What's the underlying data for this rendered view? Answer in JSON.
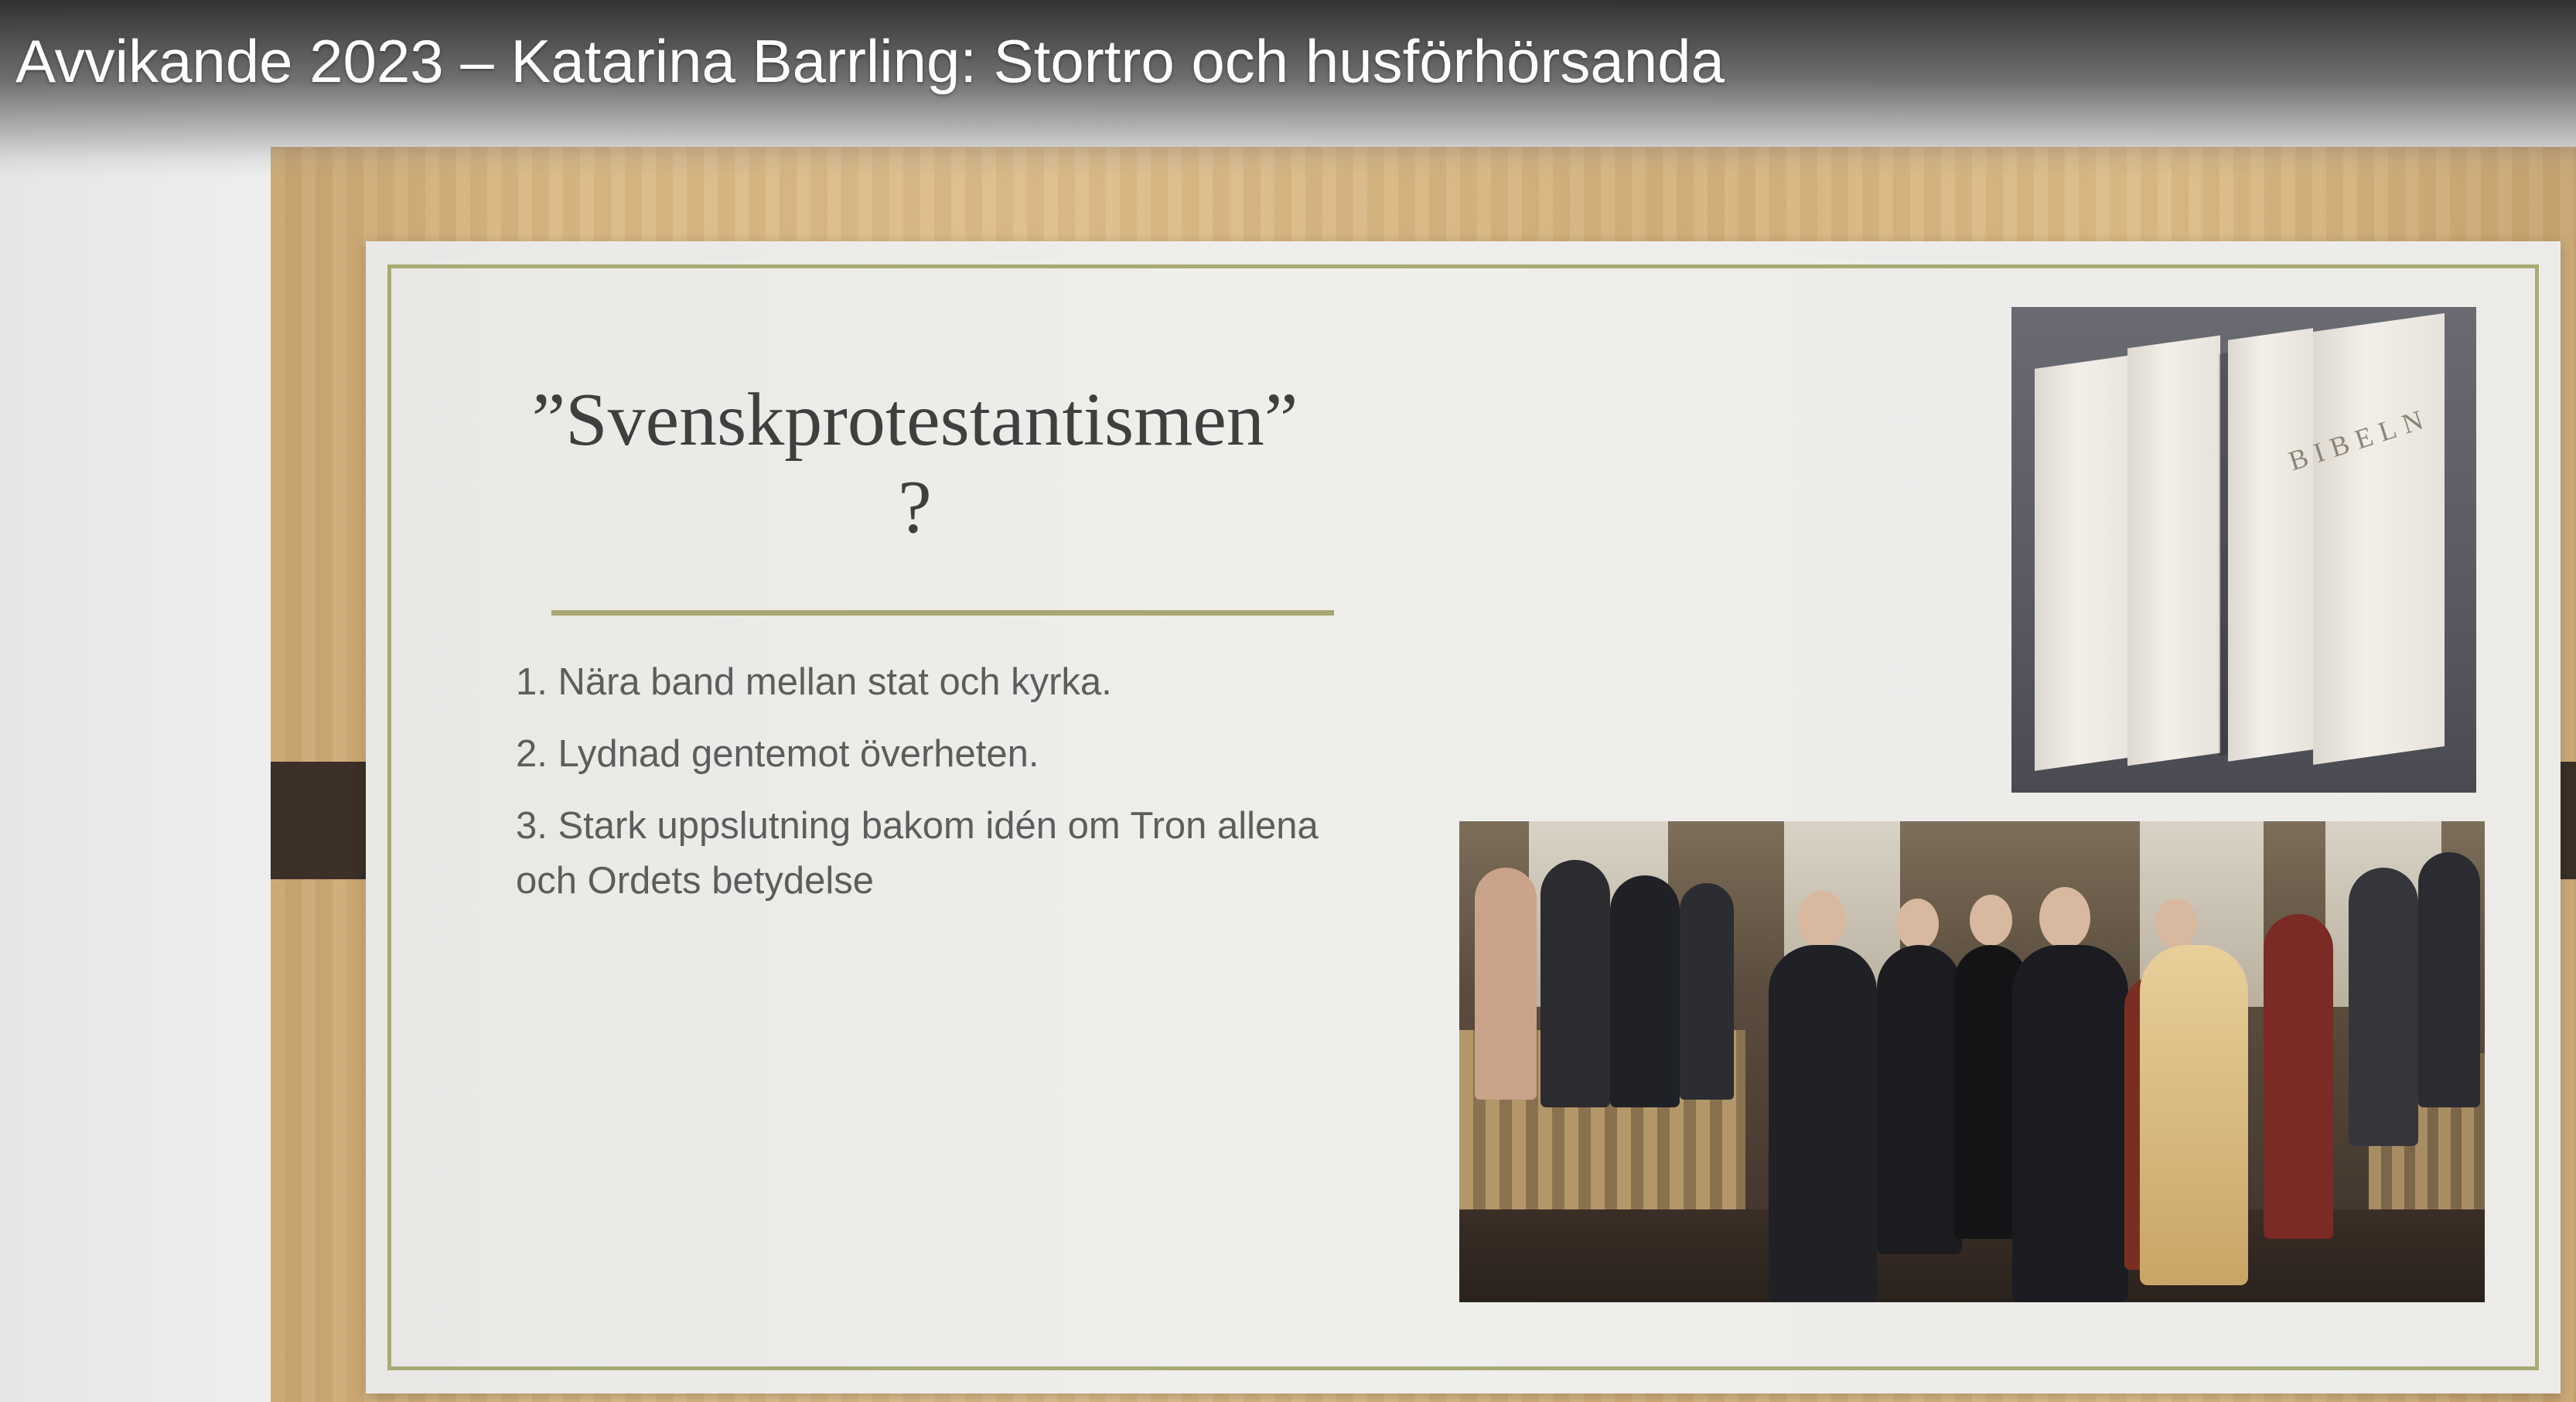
{
  "video": {
    "title": "Avvikande 2023 – Katarina Barrling: Stortro och husförhörsanda"
  },
  "slide": {
    "title_line1": "”Svenskprotestantismen”",
    "title_line2": "?",
    "bullets": [
      "1. Nära band mellan stat och kyrka.",
      "2. Lydnad gentemot överheten.",
      "3. Stark uppslutning bakom idén om Tron allena och Ordets betydelse"
    ],
    "bible_photo": {
      "cover_text": "BIBELN"
    }
  },
  "colors": {
    "accent_rule": "#a8a773",
    "slide_border": "#a8aa74",
    "wood": "#d9b884",
    "tab": "#3b2f27"
  }
}
